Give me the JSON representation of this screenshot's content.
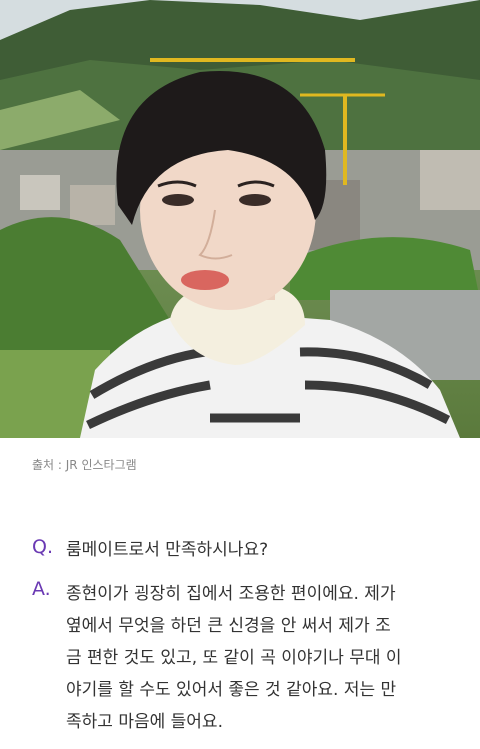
{
  "photo": {
    "alt_label": ""
  },
  "caption": {
    "text": "출처 : JR 인스타그램"
  },
  "question": {
    "marker": "Q.",
    "text": "룸메이트로서 만족하시나요?"
  },
  "answer": {
    "marker": "A.",
    "text": "종현이가 굉장히 집에서 조용한 편이에요. 제가\n옆에서 무엇을 하던 큰 신경을 안 써서 제가 조\n금 편한 것도 있고, 또 같이 곡 이야기나 무대 이\n야기를 할 수도 있어서 좋은 것 같아요. 저는 만\n족하고 마음에 들어요."
  }
}
